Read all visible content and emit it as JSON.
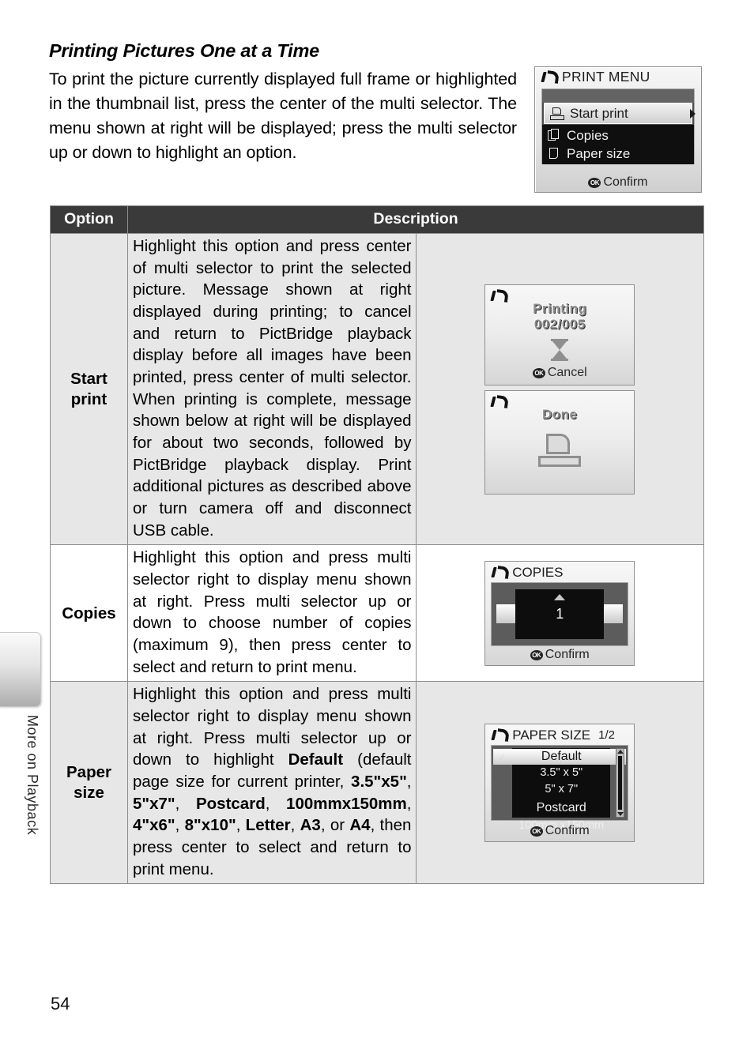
{
  "page": {
    "number": "54",
    "side_tab_label": "More on Playback"
  },
  "intro": {
    "title": "Printing Pictures One at a Time",
    "body": "To print the picture currently displayed full frame or highlighted in the thumbnail list, press the center of the multi selector.  The menu shown at right will be displayed; press the multi selector up or down to highlight an option."
  },
  "print_menu_screen": {
    "title": "PRINT MENU",
    "selected_item": "Start print",
    "items": [
      "Copies",
      "Paper size"
    ],
    "footer": "Confirm",
    "ok_label": "OK"
  },
  "table": {
    "headers": {
      "option": "Option",
      "description": "Description"
    },
    "rows": [
      {
        "option": "Start print",
        "option_line1": "Start",
        "option_line2": "print",
        "description": "Highlight this option and press center of multi selector to print the selected picture.  Message shown at right displayed during printing; to cancel and return to PictBridge playback display before all images have been printed, press center of multi selector.  When printing is complete, message shown below at right will be displayed for about two seconds, followed by PictBridge playback display.  Print additional pictures as described above or turn camera off and disconnect USB cable."
      },
      {
        "option": "Copies",
        "description": "Highlight this option and press multi selector right to display menu shown at right.  Press multi selector up or down to choose number of copies (maximum 9), then press center to select and return to print menu."
      },
      {
        "option": "Paper size",
        "option_line1": "Paper",
        "option_line2": "size",
        "description_parts": [
          {
            "t": "Highlight this option and press multi selector right to display menu shown at right.  Press multi selector up or down to highlight ",
            "b": false
          },
          {
            "t": "Default",
            "b": true
          },
          {
            "t": " (default page size for current printer, ",
            "b": false
          },
          {
            "t": "3.5\"x5\"",
            "b": true
          },
          {
            "t": ", ",
            "b": false
          },
          {
            "t": "5\"x7\"",
            "b": true
          },
          {
            "t": ", ",
            "b": false
          },
          {
            "t": "Postcard",
            "b": true
          },
          {
            "t": ", ",
            "b": false
          },
          {
            "t": "100mmx150mm",
            "b": true
          },
          {
            "t": ", ",
            "b": false
          },
          {
            "t": "4\"x6\"",
            "b": true
          },
          {
            "t": ", ",
            "b": false
          },
          {
            "t": "8\"x10\"",
            "b": true
          },
          {
            "t": ", ",
            "b": false
          },
          {
            "t": "Letter",
            "b": true
          },
          {
            "t": ", ",
            "b": false
          },
          {
            "t": "A3",
            "b": true
          },
          {
            "t": ", or ",
            "b": false
          },
          {
            "t": "A4",
            "b": true
          },
          {
            "t": ", then press center to select and return to print menu.",
            "b": false
          }
        ]
      }
    ]
  },
  "printing_screen": {
    "title": "Printing",
    "counter": "002/005",
    "footer": "Cancel",
    "ok_label": "OK"
  },
  "done_screen": {
    "title": "Done"
  },
  "copies_screen": {
    "title": "COPIES",
    "value": "1",
    "footer": "Confirm",
    "ok_label": "OK"
  },
  "paper_size_screen": {
    "title": "PAPER SIZE",
    "page_indicator": "1/2",
    "selected": "Default",
    "options": [
      "3.5\" x 5\"",
      "5\" x 7\"",
      "Postcard",
      "100mm x150mm"
    ],
    "footer": "Confirm",
    "ok_label": "OK"
  },
  "colors": {
    "table_header_bg": "#3a3a3a",
    "table_row_shade": "#e7e7e7",
    "border": "#8c8c8c"
  }
}
